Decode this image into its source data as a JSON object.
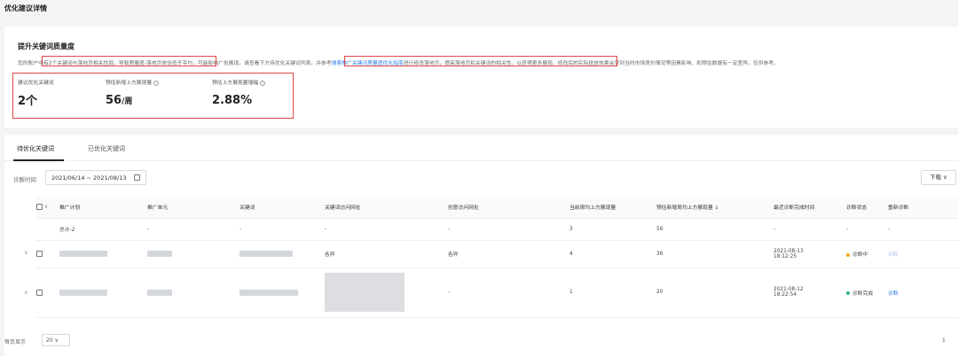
{
  "page_title": "优化建议详情",
  "section": {
    "title": "提升关键词质量度",
    "desc_parts": [
      "您的账户中有",
      "2个关键词与落地页相关性弱，导致质量度-落地页体验低于平均",
      "，可能影响广告展现，请查看下方待优化关键词列表。",
      "并参考",
      "搜索推广关键词质量度优化指南",
      "进行修改落地页，提高落地页和关键词的相关性，以获得更多展现。",
      "修改后的实际投放效果会受到当时市场竞价情况等因素影响，和预估数据有一定差异，仅供参考。"
    ]
  },
  "metrics": {
    "suggest_label": "建议优化关键词",
    "suggest_value": "2个",
    "est_label": "预估新增上方展现量",
    "est_value": "56",
    "est_unit": "/周",
    "rate_label": "预估上方展现量增幅",
    "rate_value": "2.88%"
  },
  "tabs": [
    "待优化关键词",
    "已优化关键词"
  ],
  "filter": {
    "date_label": "诊断时间",
    "date_range": "2021/06/14 ~ 2021/08/13",
    "download": "下载 ∨"
  },
  "table": {
    "headers": [
      "推广计划",
      "推广单元",
      "关键词",
      "关键词访问网址",
      "创意访问网址",
      "当前周均上方展现量",
      "预估新增周均上方展现量 ↓",
      "最近诊断完成时间",
      "诊断状态",
      "重新诊断"
    ],
    "total_row": [
      "总计-2",
      "-",
      "-",
      "-",
      "-",
      "3",
      "56",
      "-",
      "-",
      "-"
    ],
    "rows": [
      {
        "kw_url": "各异",
        "creative_url": "各异",
        "current": "4",
        "estimated": "36",
        "time_date": "2021-08-13",
        "time_clock": "18:12:25",
        "status": "诊断中",
        "status_color": "#f5a623",
        "action": "诊断"
      },
      {
        "kw_url": "",
        "creative_url": "-",
        "current": "1",
        "estimated": "20",
        "time_date": "2021-08-12",
        "time_clock": "18:22:54",
        "status": "诊断完成",
        "status_color": "#2bb673",
        "action": "诊断"
      }
    ]
  },
  "pagination": {
    "per_page_label": "每页显示",
    "per_page": "20 ∨",
    "page": "1"
  }
}
